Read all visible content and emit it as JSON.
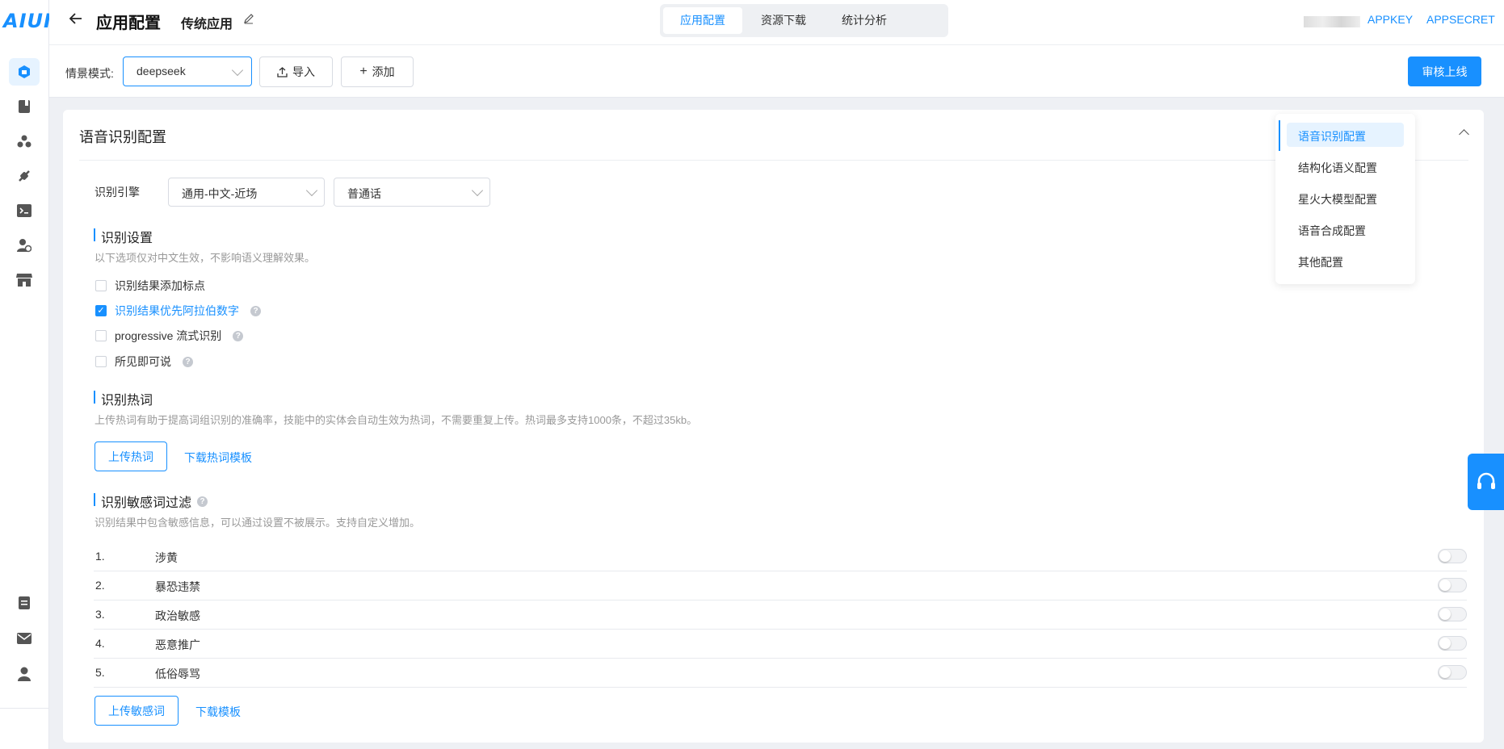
{
  "brand": {
    "logo_text": "AIUI",
    "accent": "#1890ff"
  },
  "sidebar": {
    "items": [
      {
        "icon": "app-icon",
        "active": true
      },
      {
        "icon": "book-icon"
      },
      {
        "icon": "skills-icon"
      },
      {
        "icon": "plugin-icon"
      },
      {
        "icon": "terminal-icon"
      },
      {
        "icon": "user-settings-icon"
      },
      {
        "icon": "store-icon"
      }
    ],
    "bottom": [
      {
        "icon": "document-icon"
      },
      {
        "icon": "mail-icon"
      },
      {
        "icon": "user-icon"
      }
    ]
  },
  "header": {
    "title": "应用配置",
    "app_name": "传统应用",
    "tabs": [
      {
        "label": "应用配置",
        "active": true
      },
      {
        "label": "资源下载"
      },
      {
        "label": "统计分析"
      }
    ],
    "appkey_label": "APPKEY",
    "appsecret_label": "APPSECRET"
  },
  "toolbar": {
    "mode_label": "情景模式:",
    "mode_value": "deepseek",
    "import_label": "导入",
    "add_label": "添加",
    "publish_label": "审核上线"
  },
  "asr": {
    "title": "语音识别配置",
    "engine_label": "识别引擎",
    "engine_value": "通用-中文-近场",
    "language_value": "普通话",
    "settings": {
      "title": "识别设置",
      "desc": "以下选项仅对中文生效，不影响语义理解效果。",
      "options": [
        {
          "label": "识别结果添加标点",
          "checked": false,
          "help": false
        },
        {
          "label": "识别结果优先阿拉伯数字",
          "checked": true,
          "help": true
        },
        {
          "label": "progressive 流式识别",
          "checked": false,
          "help": true
        },
        {
          "label": "所见即可说",
          "checked": false,
          "help": true
        }
      ]
    },
    "hotwords": {
      "title": "识别热词",
      "desc": "上传热词有助于提高词组识别的准确率，技能中的实体会自动生效为热词，不需要重复上传。热词最多支持1000条，不超过35kb。",
      "upload_label": "上传热词",
      "template_label": "下载热词模板"
    },
    "sensitive": {
      "title": "识别敏感词过滤",
      "desc": "识别结果中包含敏感信息，可以通过设置不被展示。支持自定义增加。",
      "rows": [
        {
          "num": "1.",
          "name": "涉黄",
          "enabled": false
        },
        {
          "num": "2.",
          "name": "暴恐违禁",
          "enabled": false
        },
        {
          "num": "3.",
          "name": "政治敏感",
          "enabled": false
        },
        {
          "num": "4.",
          "name": "恶意推广",
          "enabled": false
        },
        {
          "num": "5.",
          "name": "低俗辱骂",
          "enabled": false
        }
      ],
      "upload_label": "上传敏感词",
      "template_label": "下载模板"
    }
  },
  "anchor_nav": {
    "items": [
      {
        "label": "语音识别配置",
        "active": true
      },
      {
        "label": "结构化语义配置"
      },
      {
        "label": "星火大模型配置"
      },
      {
        "label": "语音合成配置"
      },
      {
        "label": "其他配置"
      }
    ]
  }
}
